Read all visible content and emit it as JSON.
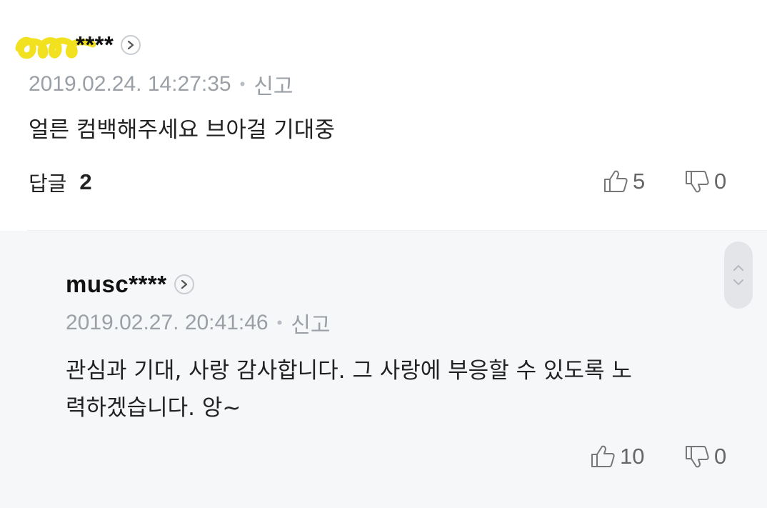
{
  "comment": {
    "username": "****",
    "timestamp": "2019.02.24. 14:27:35",
    "separator": "•",
    "report_label": "신고",
    "text": "얼른 컴백해주세요 브아걸 기대중",
    "replies_label": "답글",
    "replies_count": "2",
    "likes": "5",
    "dislikes": "0"
  },
  "reply": {
    "username": "musc****",
    "timestamp": "2019.02.27. 20:41:46",
    "separator": "•",
    "report_label": "신고",
    "text_line1": "관심과 기대, 사랑 감사합니다. 그 사랑에 부응할 수 있도록 노",
    "text_line2": "력하겠습니다. 앙~",
    "likes": "10",
    "dislikes": "0"
  },
  "colors": {
    "highlight": "#f2e11f",
    "reply_bg": "#f6f7f9",
    "meta_text": "#9aa0a6"
  },
  "icons": {
    "profile_arrow": "chevron-right-icon",
    "like": "thumbs-up-icon",
    "dislike": "thumbs-down-icon",
    "scroll_up": "chevron-up-icon",
    "scroll_down": "chevron-down-icon"
  }
}
